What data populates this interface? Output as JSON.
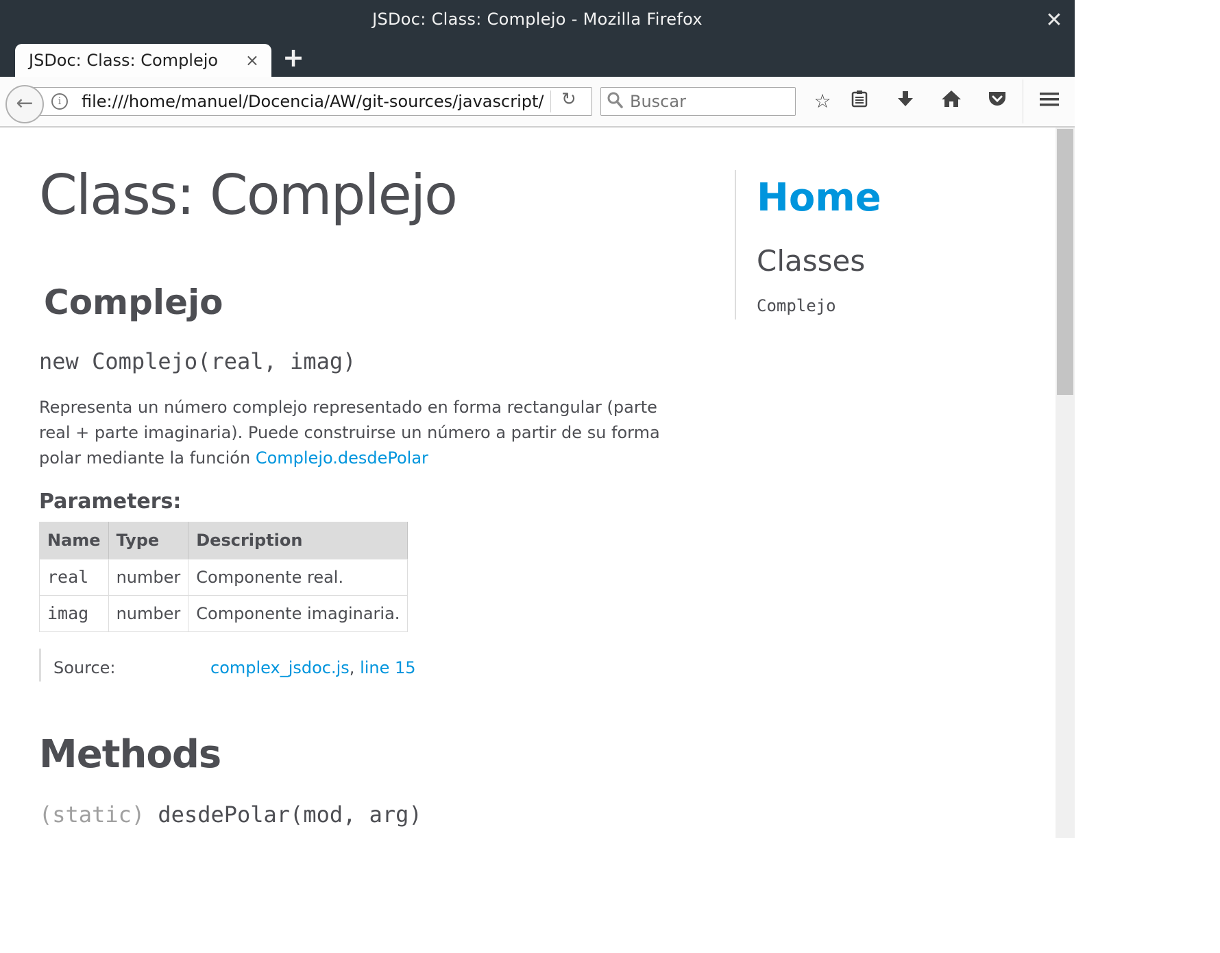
{
  "window": {
    "title": "JSDoc: Class: Complejo - Mozilla Firefox",
    "close_glyph": "✕"
  },
  "tabs": [
    {
      "label": "JSDoc: Class: Complejo",
      "close_glyph": "×",
      "active": true
    }
  ],
  "new_tab_glyph": "+",
  "navbar": {
    "url": "file:///home/manuel/Docencia/AW/git-sources/javascript/",
    "search_placeholder": "Buscar",
    "icons": [
      "back-arrow-icon",
      "info-icon",
      "reload-icon",
      "search-icon",
      "bookmark-star-icon",
      "reading-list-icon",
      "download-icon",
      "home-icon",
      "pocket-icon",
      "menu-icon"
    ]
  },
  "page": {
    "title": "Class: Complejo",
    "class_name": "Complejo",
    "constructor_signature": "new Complejo(real, imag)",
    "description_text": "Representa un número complejo representado en forma rectangular (parte real + parte imaginaria). Puede construirse un número a partir de su forma polar mediante la función ",
    "description_link": "Complejo.desdePolar",
    "parameters_heading": "Parameters:",
    "parameters_table": {
      "headers": [
        "Name",
        "Type",
        "Description"
      ],
      "rows": [
        [
          "real",
          "number",
          "Componente real."
        ],
        [
          "imag",
          "number",
          "Componente imaginaria."
        ]
      ]
    },
    "source": {
      "label": "Source:",
      "file_link": "complex_jsdoc.js",
      "separator": ", ",
      "line_link": "line 15"
    },
    "methods_heading": "Methods",
    "method": {
      "attribute": "(static)",
      "signature": " desdePolar(mod, arg)"
    }
  },
  "sidenav": {
    "home": "Home",
    "classes_heading": "Classes",
    "classes": [
      "Complejo"
    ]
  },
  "colors": {
    "link": "#0095dd",
    "text": "#4d4e53",
    "chrome_dark": "#2b343c"
  }
}
